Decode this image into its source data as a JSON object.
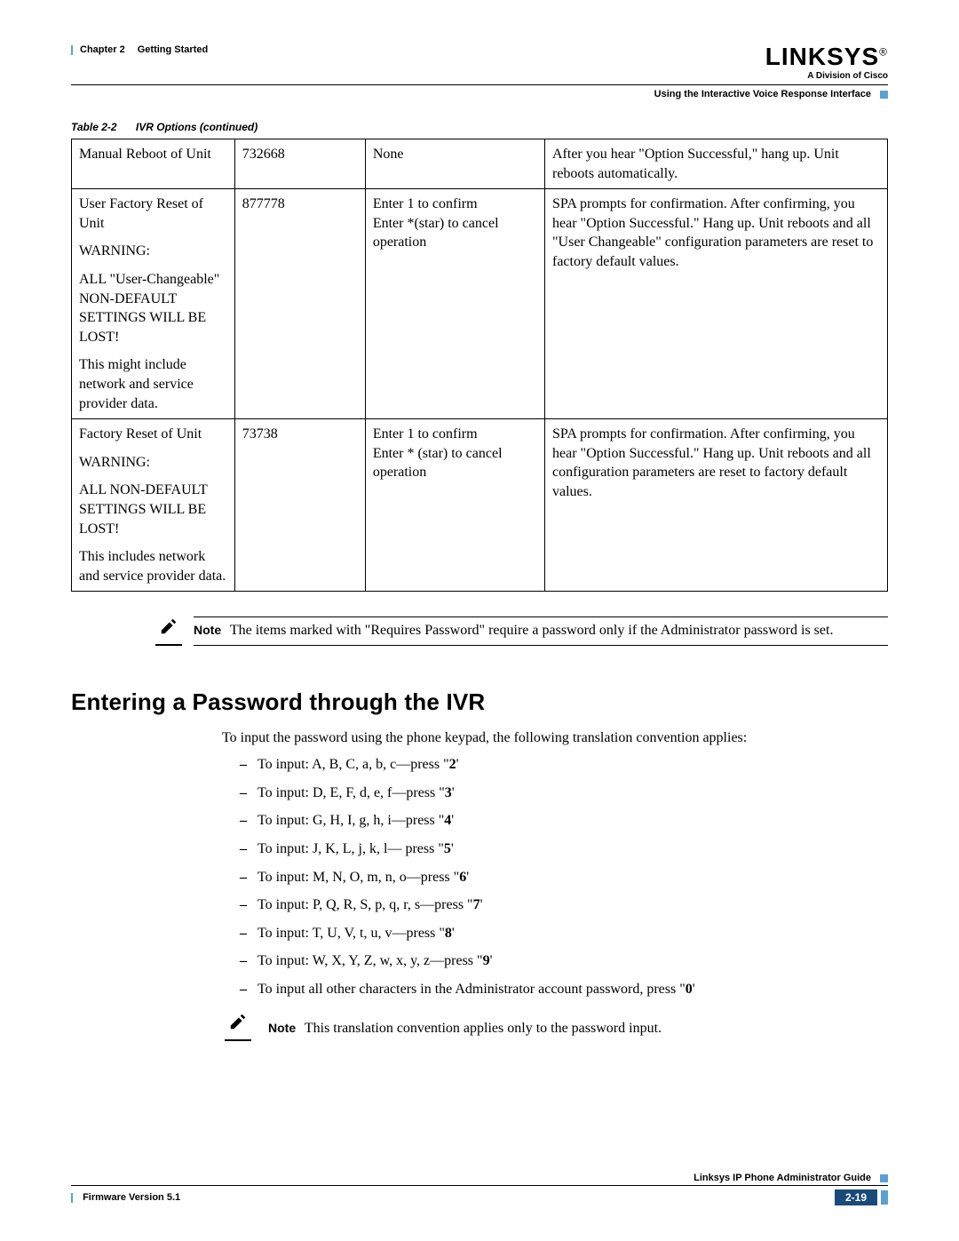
{
  "header": {
    "chapter": "Chapter 2",
    "title": "Getting Started",
    "logo": "LINKSYS",
    "logo_reg": "®",
    "logo_sub": "A Division of Cisco",
    "sub_right": "Using the Interactive Voice Response Interface"
  },
  "table": {
    "caption_label": "Table 2-2",
    "caption_title": "IVR Options (continued)",
    "rows": [
      {
        "c1": "Manual Reboot of Unit",
        "c2": "732668",
        "c3": "None",
        "c4": "After you hear \"Option Successful,\" hang up. Unit reboots automatically."
      },
      {
        "c1_p1": "User Factory Reset of Unit",
        "c1_p2": "WARNING:",
        "c1_p3": "ALL \"User-Changeable\" NON-DEFAULT SETTINGS WILL BE LOST!",
        "c1_p4": "This might include network and service provider data.",
        "c2": "877778",
        "c3": "Enter 1 to confirm\nEnter *(star) to cancel operation",
        "c4": "SPA prompts for confirmation. After confirming, you hear \"Option Successful.\" Hang up. Unit reboots and all \"User Changeable\" configuration parameters are reset to factory default values."
      },
      {
        "c1_p1": "Factory Reset of Unit",
        "c1_p2": "WARNING:",
        "c1_p3": "ALL NON-DEFAULT SETTINGS WILL BE LOST!",
        "c1_p4": "This includes network and service provider data.",
        "c2": "73738",
        "c3": "Enter 1 to confirm\nEnter * (star) to cancel operation",
        "c4": "SPA prompts for confirmation. After confirming, you hear \"Option Successful.\" Hang up. Unit reboots and all configuration parameters are reset to factory default values."
      }
    ]
  },
  "note1": {
    "label": "Note",
    "text": "The items marked with \"Requires Password\" require a password only if the Administrator password is set."
  },
  "section": {
    "heading": "Entering a Password through the IVR",
    "intro": "To input the password using the phone keypad, the following translation convention applies:",
    "items": [
      "To input: A, B, C, a, b, c—press \"2'",
      "To input: D, E, F, d, e, f—press \"3'",
      "To input: G, H, I, g, h, i—press \"4'",
      "To input: J, K, L, j, k, l— press \"5'",
      "To input: M, N, O, m, n, o—press \"6'",
      "To input: P, Q, R, S, p, q, r, s—press \"7'",
      "To input: T, U, V, t, u, v—press \"8'",
      "To input: W, X, Y, Z, w, x, y, z—press \"9'",
      "To input all other characters in the Administrator account password, press \"0'"
    ]
  },
  "note2": {
    "label": "Note",
    "text": "This translation convention applies only to the password input."
  },
  "footer": {
    "guide": "Linksys IP Phone Administrator Guide",
    "version": "Firmware Version 5.1",
    "page": "2-19"
  }
}
